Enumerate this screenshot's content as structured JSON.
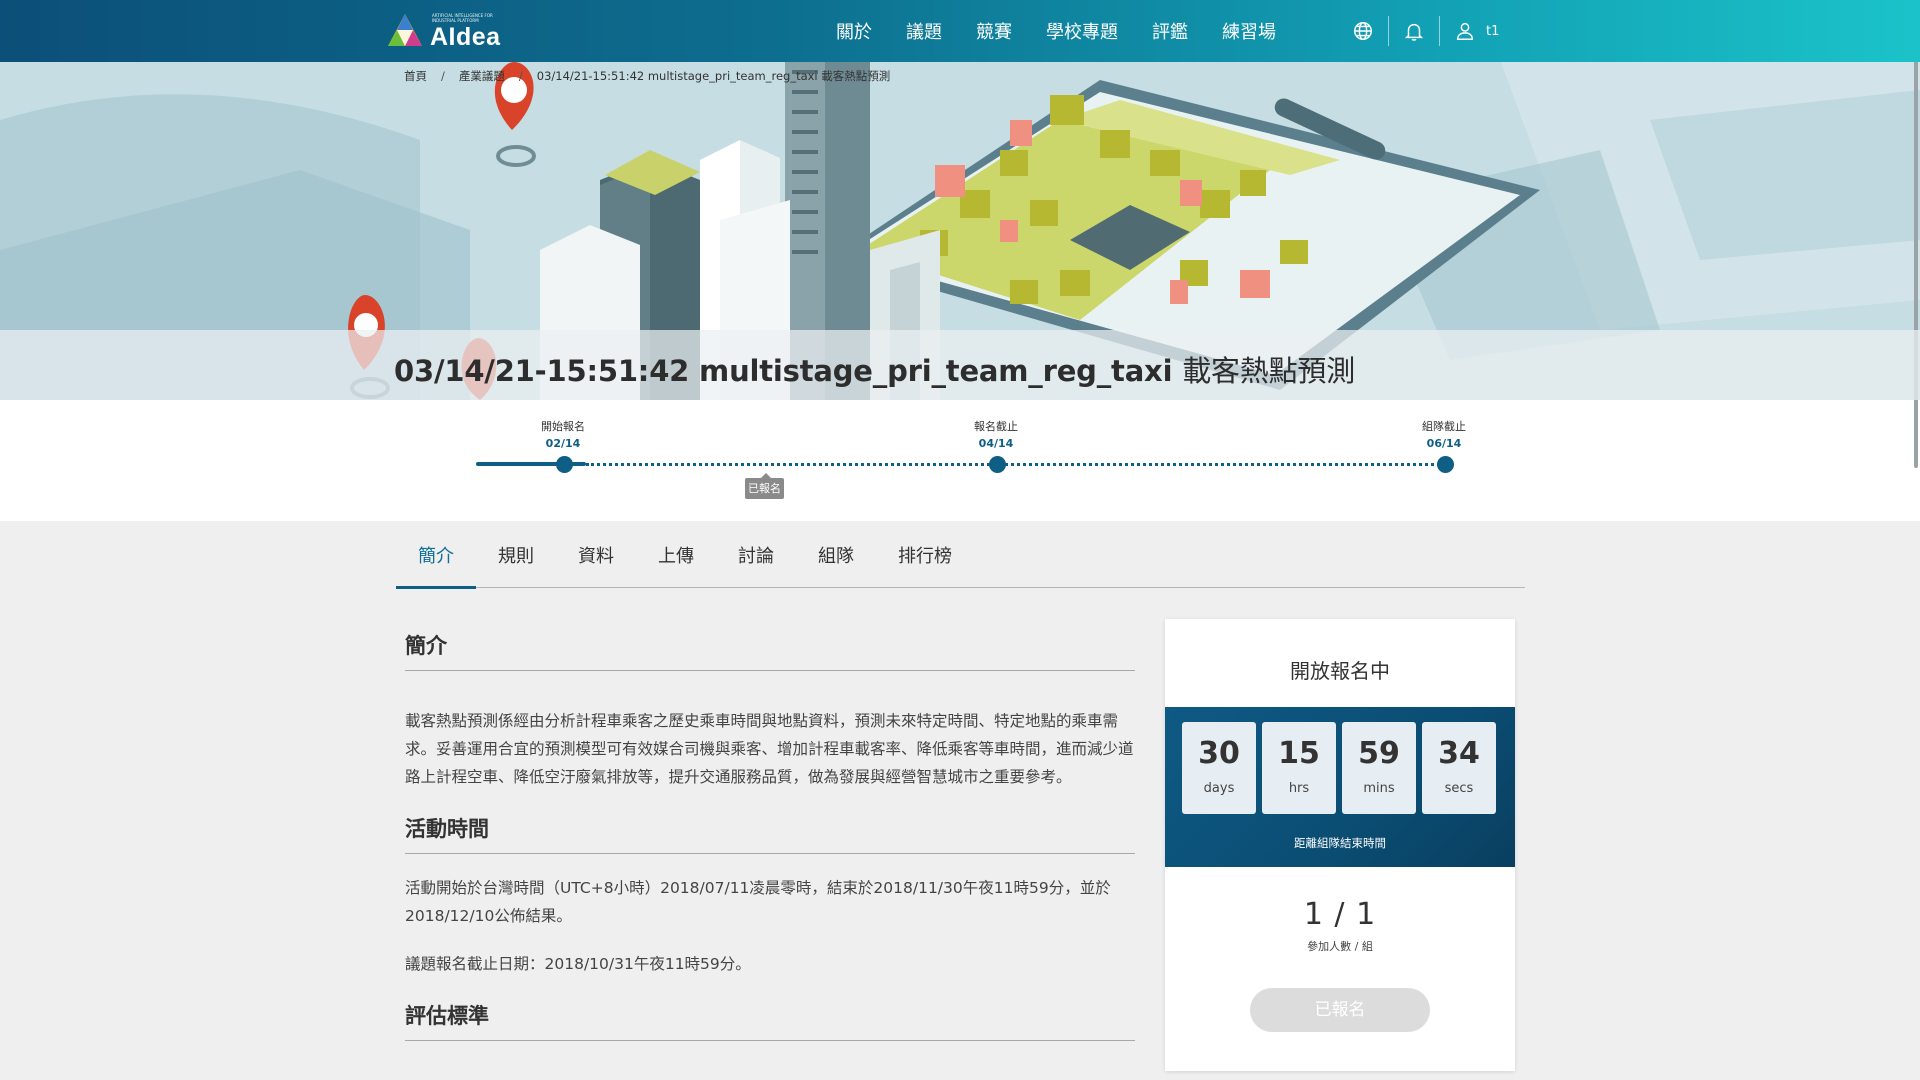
{
  "logo": {
    "text": "AIdea",
    "tagline": "ARTIFICIAL INTELLIGENCE FOR INDUSTRIAL PLATFORM"
  },
  "nav": {
    "items": [
      "關於",
      "議題",
      "競賽",
      "學校專題",
      "評鑑",
      "練習場"
    ],
    "user": "t1",
    "icons": [
      "globe-icon",
      "bell-icon",
      "user-icon"
    ]
  },
  "breadcrumb": {
    "home": "首頁",
    "category": "產業議題",
    "current": "03/14/21-15:51:42 multistage_pri_team_reg_taxi 載客熱點預測"
  },
  "title": {
    "main": "03/14/21-15:51:42 multistage_pri_team_reg_taxi",
    "zh": "載客熱點預測"
  },
  "timeline": {
    "milestones": [
      {
        "label": "開始報名",
        "date": "02/14"
      },
      {
        "label": "報名截止",
        "date": "04/14"
      },
      {
        "label": "組隊截止",
        "date": "06/14"
      }
    ],
    "badge": "已報名",
    "progress": 0.09
  },
  "tabs": [
    "簡介",
    "規則",
    "資料",
    "上傳",
    "討論",
    "組隊",
    "排行榜"
  ],
  "active_tab": "簡介",
  "content": {
    "intro_title": "簡介",
    "intro_text": "載客熱點預測係經由分析計程車乘客之歷史乘車時間與地點資料，預測未來特定時間、特定地點的乘車需求。妥善運用合宜的預測模型可有效媒合司機與乘客、增加計程車載客率、降低乘客等車時間，進而減少道路上計程空車、降低空汙廢氣排放等，提升交通服務品質，做為發展與經營智慧城市之重要參考。",
    "time_title": "活動時間",
    "time_text": "活動開始於台灣時間（UTC+8小時）2018/07/11凌晨零時，結束於2018/11/30午夜11時59分，並於2018/12/10公佈結果。",
    "deadline_text": "議題報名截止日期：2018/10/31午夜11時59分。",
    "eval_title": "評估標準"
  },
  "card": {
    "status": "開放報名中",
    "countdown": [
      {
        "value": "30",
        "unit": "days"
      },
      {
        "value": "15",
        "unit": "hrs"
      },
      {
        "value": "59",
        "unit": "mins"
      },
      {
        "value": "34",
        "unit": "secs"
      }
    ],
    "countdown_caption": "距離組隊結束時間",
    "members": "1 / 1",
    "members_label": "參加人數 / 組",
    "button": "已報名"
  },
  "colors": {
    "primary": "#0e5e86",
    "nav_start": "#0c4f78",
    "nav_end": "#1bc3c9",
    "active_tab": "#0e6d99",
    "countdown_bg": "#0b4d73"
  }
}
